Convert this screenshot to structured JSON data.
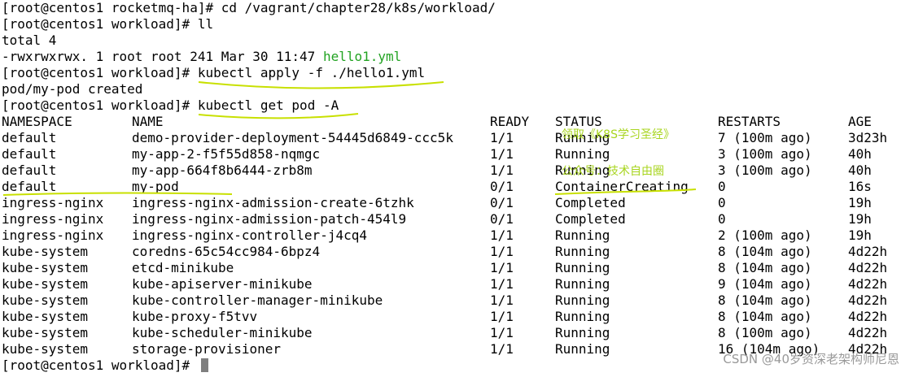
{
  "terminal": {
    "lines": [
      {
        "prompt": "[root@centos1 rocketmq-ha]# ",
        "command": "cd /vagrant/chapter28/k8s/workload/"
      },
      {
        "prompt": "[root@centos1 workload]# ",
        "command": "ll"
      },
      {
        "output": "total 4"
      },
      {
        "output": "-rwxrwxrwx. 1 root root 241 Mar 30 11:47 ",
        "file": "hello1.yml"
      },
      {
        "prompt": "[root@centos1 workload]# ",
        "command": "kubectl apply -f ./hello1.yml"
      },
      {
        "output": "pod/my-pod created"
      },
      {
        "prompt": "[root@centos1 workload]# ",
        "command": "kubectl get pod -A"
      }
    ],
    "final_prompt": "[root@centos1 workload]# ",
    "table": {
      "headers": [
        "NAMESPACE",
        "NAME",
        "READY",
        "STATUS",
        "RESTARTS",
        "AGE"
      ],
      "rows": [
        [
          "default",
          "demo-provider-deployment-54445d6849-ccc5k",
          "1/1",
          "Running",
          "7 (100m ago)",
          "3d23h"
        ],
        [
          "default",
          "my-app-2-f5f55d858-nqmgc",
          "1/1",
          "Running",
          "3 (100m ago)",
          "40h"
        ],
        [
          "default",
          "my-app-664f8b6444-zrb8m",
          "1/1",
          "Running",
          "3 (100m ago)",
          "40h"
        ],
        [
          "default",
          "my-pod",
          "0/1",
          "ContainerCreating",
          "0",
          "16s"
        ],
        [
          "ingress-nginx",
          "ingress-nginx-admission-create-6tzhk",
          "0/1",
          "Completed",
          "0",
          "19h"
        ],
        [
          "ingress-nginx",
          "ingress-nginx-admission-patch-454l9",
          "0/1",
          "Completed",
          "0",
          "19h"
        ],
        [
          "ingress-nginx",
          "ingress-nginx-controller-j4cq4",
          "1/1",
          "Running",
          "2 (100m ago)",
          "19h"
        ],
        [
          "kube-system",
          "coredns-65c54cc984-6bpz4",
          "1/1",
          "Running",
          "8 (104m ago)",
          "4d22h"
        ],
        [
          "kube-system",
          "etcd-minikube",
          "1/1",
          "Running",
          "8 (104m ago)",
          "4d22h"
        ],
        [
          "kube-system",
          "kube-apiserver-minikube",
          "1/1",
          "Running",
          "9 (104m ago)",
          "4d22h"
        ],
        [
          "kube-system",
          "kube-controller-manager-minikube",
          "1/1",
          "Running",
          "8 (104m ago)",
          "4d22h"
        ],
        [
          "kube-system",
          "kube-proxy-f5tvv",
          "1/1",
          "Running",
          "8 (104m ago)",
          "4d22h"
        ],
        [
          "kube-system",
          "kube-scheduler-minikube",
          "1/1",
          "Running",
          "8 (100m ago)",
          "4d22h"
        ],
        [
          "kube-system",
          "storage-provisioner",
          "1/1",
          "Running",
          "16 (104m ago)",
          "4d22h"
        ]
      ]
    }
  },
  "overlays": {
    "line1": "领取《K8S学习圣经》",
    "line2": "公众号：技术自由圈"
  },
  "watermark": "CSDN @40岁资深老架构师尼恩",
  "colors": {
    "background": "#ffffff",
    "text": "#000000",
    "filename": "#22a322",
    "annotation": "#a8d51f"
  },
  "icons": {
    "cursor": "block-cursor"
  }
}
